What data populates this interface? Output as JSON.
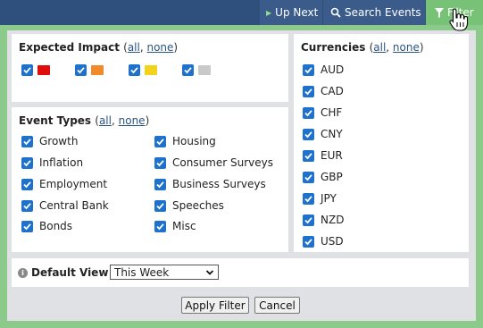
{
  "topbar": {
    "up_next_label": "Up Next",
    "search_label": "Search Events",
    "filter_label": "Filter"
  },
  "impact": {
    "title": "Expected Impact",
    "all_link": "all",
    "none_link": "none",
    "levels": [
      {
        "color": "#e00d0d",
        "checked": true
      },
      {
        "color": "#f08a2b",
        "checked": true
      },
      {
        "color": "#f2d21b",
        "checked": true
      },
      {
        "color": "#c9c9c9",
        "checked": true
      }
    ]
  },
  "event_types": {
    "title": "Event Types",
    "all_link": "all",
    "none_link": "none",
    "items": [
      "Growth",
      "Housing",
      "Inflation",
      "Consumer Surveys",
      "Employment",
      "Business Surveys",
      "Central Bank",
      "Speeches",
      "Bonds",
      "Misc"
    ]
  },
  "currencies": {
    "title": "Currencies",
    "all_link": "all",
    "none_link": "none",
    "items": [
      "AUD",
      "CAD",
      "CHF",
      "CNY",
      "EUR",
      "GBP",
      "JPY",
      "NZD",
      "USD"
    ]
  },
  "default_view": {
    "label": "Default View",
    "selected": "This Week"
  },
  "buttons": {
    "apply": "Apply Filter",
    "cancel": "Cancel"
  },
  "colors": {
    "topbar": "#2f4f7d",
    "active_tab": "#77c277",
    "checkbox": "#1e71cc"
  }
}
